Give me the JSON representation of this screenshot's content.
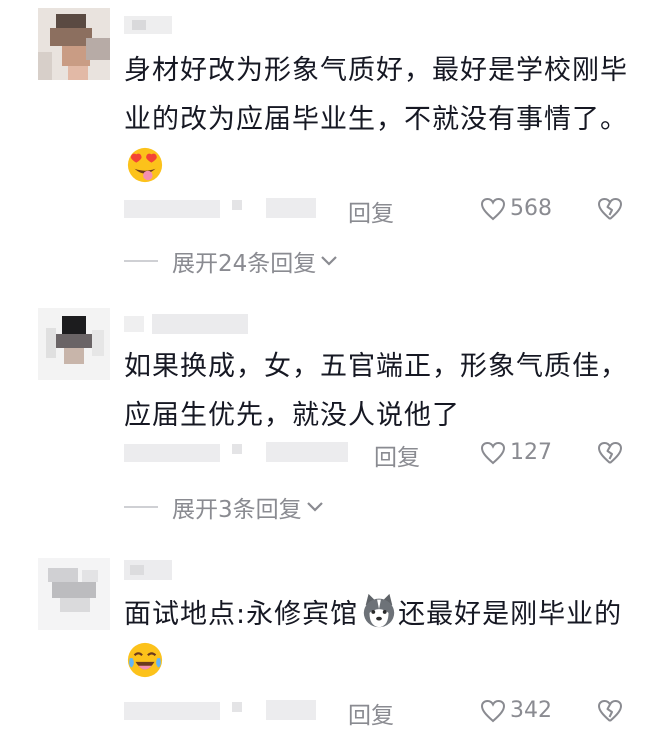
{
  "comments": [
    {
      "text": "身材好改为形象气质好，最好是学校刚毕业的改为应届毕业生，不就没有事情了。",
      "emoji": "heart-eyes-tongue-emoji",
      "reply_label": "回复",
      "like_count": "568",
      "expand_label": "展开24条回复"
    },
    {
      "text": "如果换成，女，五官端正，形象气质佳，应届生优先，就没人说他了",
      "reply_label": "回复",
      "like_count": "127",
      "expand_label": "展开3条回复"
    },
    {
      "text": "面试地点:永修宾馆",
      "text2": "还最好是刚毕业的",
      "emoji_inline": "husky-dog-emoji",
      "emoji_end": "laughing-crying-emoji",
      "reply_label": "回复",
      "like_count": "342"
    }
  ],
  "colors": {
    "text": "#161823",
    "meta": "#8a8b91",
    "line": "#cfd0d4"
  }
}
